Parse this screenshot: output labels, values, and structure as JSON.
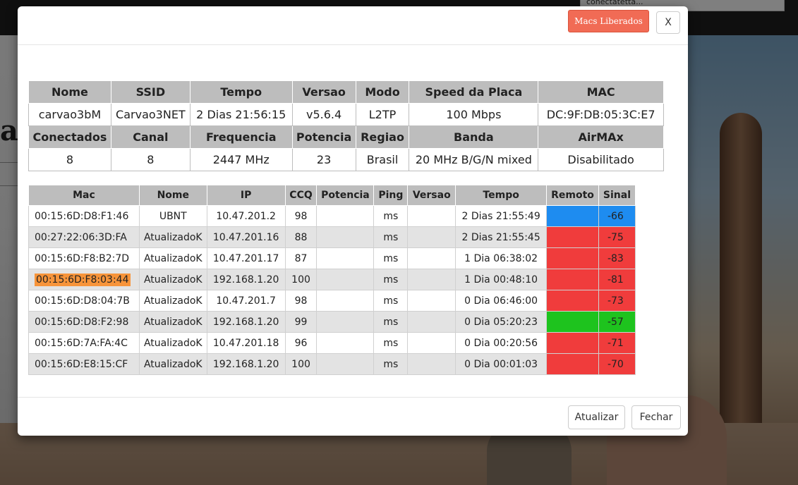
{
  "background": {
    "letters": "ar",
    "dropdown_text": "conectatetta..."
  },
  "modal": {
    "macs_button": "Macs Liberados",
    "close_x": "X",
    "update_button": "Atualizar",
    "close_button": "Fechar"
  },
  "info": {
    "headers1": [
      "Nome",
      "SSID",
      "Tempo",
      "Versao",
      "Modo",
      "Speed da Placa",
      "MAC"
    ],
    "values1": [
      "carvao3bM",
      "Carvao3NET",
      "2 Dias 21:56:15",
      "v5.6.4",
      "L2TP",
      "100 Mbps",
      "DC:9F:DB:05:3C:E7"
    ],
    "headers2": [
      "Conectados",
      "Canal",
      "Frequencia",
      "Potencia",
      "Regiao",
      "Banda",
      "AirMAx"
    ],
    "values2": [
      "8",
      "8",
      "2447 MHz",
      "23",
      "Brasil",
      "20 MHz B/G/N mixed",
      "Disabilitado"
    ]
  },
  "clients": {
    "headers": [
      "Mac",
      "Nome",
      "IP",
      "CCQ",
      "Potencia",
      "Ping",
      "Versao",
      "Tempo",
      "Remoto",
      "Sinal"
    ],
    "rows": [
      {
        "mac": "00:15:6D:D8:F1:46",
        "nome": "UBNT",
        "ip": "10.47.201.2",
        "ccq": "98",
        "potencia": "",
        "ping": "ms",
        "versao": "",
        "tempo": "2 Dias 21:55:49",
        "sinal": "-66",
        "color": "#1e8cf0"
      },
      {
        "mac": "00:27:22:06:3D:FA",
        "nome": "AtualizadoK",
        "ip": "10.47.201.16",
        "ccq": "88",
        "potencia": "",
        "ping": "ms",
        "versao": "",
        "tempo": "2 Dias 21:55:45",
        "sinal": "-75",
        "color": "#f03c3c"
      },
      {
        "mac": "00:15:6D:F8:B2:7D",
        "nome": "AtualizadoK",
        "ip": "10.47.201.17",
        "ccq": "87",
        "potencia": "",
        "ping": "ms",
        "versao": "",
        "tempo": "1 Dia 06:38:02",
        "sinal": "-83",
        "color": "#f03c3c"
      },
      {
        "mac": "00:15:6D:F8:03:44",
        "nome": "AtualizadoK",
        "ip": "192.168.1.20",
        "ccq": "100",
        "potencia": "",
        "ping": "ms",
        "versao": "",
        "tempo": "1 Dia 00:48:10",
        "sinal": "-81",
        "color": "#f03c3c",
        "highlight": true
      },
      {
        "mac": "00:15:6D:D8:04:7B",
        "nome": "AtualizadoK",
        "ip": "10.47.201.7",
        "ccq": "98",
        "potencia": "",
        "ping": "ms",
        "versao": "",
        "tempo": "0 Dia 06:46:00",
        "sinal": "-73",
        "color": "#f03c3c"
      },
      {
        "mac": "00:15:6D:D8:F2:98",
        "nome": "AtualizadoK",
        "ip": "192.168.1.20",
        "ccq": "99",
        "potencia": "",
        "ping": "ms",
        "versao": "",
        "tempo": "0 Dia 05:20:23",
        "sinal": "-57",
        "color": "#1ec31e"
      },
      {
        "mac": "00:15:6D:7A:FA:4C",
        "nome": "AtualizadoK",
        "ip": "10.47.201.18",
        "ccq": "96",
        "potencia": "",
        "ping": "ms",
        "versao": "",
        "tempo": "0 Dia 00:20:56",
        "sinal": "-71",
        "color": "#f03c3c"
      },
      {
        "mac": "00:15:6D:E8:15:CF",
        "nome": "AtualizadoK",
        "ip": "192.168.1.20",
        "ccq": "100",
        "potencia": "",
        "ping": "ms",
        "versao": "",
        "tempo": "0 Dia 00:01:03",
        "sinal": "-70",
        "color": "#f03c3c"
      }
    ]
  }
}
